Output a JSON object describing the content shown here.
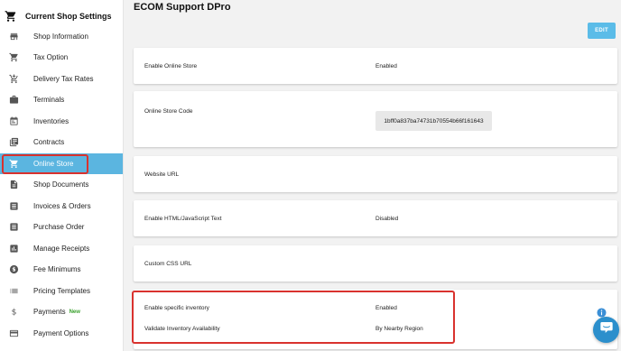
{
  "sidebar": {
    "title": "Current Shop Settings",
    "title_icon": "cart-icon",
    "items": [
      {
        "label": "Shop Information",
        "icon": "store-icon"
      },
      {
        "label": "Tax Option",
        "icon": "cart-icon"
      },
      {
        "label": "Delivery Tax Rates",
        "icon": "cart-plus-icon"
      },
      {
        "label": "Terminals",
        "icon": "briefcase-icon"
      },
      {
        "label": "Inventories",
        "icon": "calendar-list-icon"
      },
      {
        "label": "Contracts",
        "icon": "library-icon"
      },
      {
        "label": "Online Store",
        "icon": "cart-icon",
        "active": true
      },
      {
        "label": "Shop Documents",
        "icon": "document-icon"
      },
      {
        "label": "Invoices & Orders",
        "icon": "invoice-icon"
      },
      {
        "label": "Purchase Order",
        "icon": "list-box-icon"
      },
      {
        "label": "Manage Receipts",
        "icon": "bar-chart-icon"
      },
      {
        "label": "Fee Minimums",
        "icon": "dollar-circle-icon"
      },
      {
        "label": "Pricing Templates",
        "icon": "list-icon"
      },
      {
        "label": "Payments",
        "icon": "dollar-icon",
        "badge": "New"
      },
      {
        "label": "Payment Options",
        "icon": "credit-card-icon"
      }
    ]
  },
  "main": {
    "title": "ECOM Support DPro",
    "edit_label": "EDIT",
    "rows": {
      "enable_online_store": {
        "label": "Enable Online Store",
        "value": "Enabled"
      },
      "online_store_code": {
        "label": "Online Store Code",
        "value": "1bff0a837ba74731b70554b66f161643"
      },
      "website_url": {
        "label": "Website URL",
        "value": ""
      },
      "enable_html": {
        "label": "Enable HTML/JavaScript Text",
        "value": "Disabled"
      },
      "custom_css": {
        "label": "Custom CSS URL",
        "value": ""
      },
      "enable_specific_inventory": {
        "label": "Enable specific inventory",
        "value": "Enabled"
      },
      "validate_inventory": {
        "label": "Validate Inventory Availability",
        "value": "By Nearby Region"
      }
    }
  },
  "colors": {
    "accent": "#5bb5e0",
    "edit_button": "#5bbce8",
    "highlight": "#d9322e",
    "badge_new": "#3aa02d",
    "chat_button": "#2c8fcc"
  }
}
